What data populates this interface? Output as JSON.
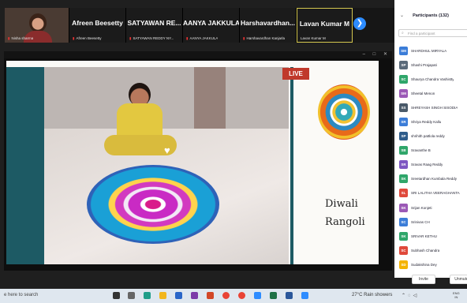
{
  "strip": {
    "self": {
      "name": "Nisha sharma"
    },
    "tiles": [
      {
        "big": "Afreen Beesetty",
        "small": "Afreen Beesetty"
      },
      {
        "big": "SATYAWAN RE...",
        "small": "SATYAWAN REDDY NY..."
      },
      {
        "big": "AANYA JAKKULA",
        "small": "AANYA JAKKULA"
      },
      {
        "big": "Harshavardhan...",
        "small": "Harshavardhan Kanjarla"
      },
      {
        "big": "Lavan Kumar M",
        "small": "Lavan Kumar M"
      }
    ],
    "next_icon": "chevron-right-icon"
  },
  "share": {
    "live_label": "LIVE",
    "title_line1": "Diwali",
    "title_line2": "Rangoli"
  },
  "panel": {
    "title": "Participants (132)",
    "search_placeholder": "Find a participant",
    "participants": [
      {
        "initials": "SM",
        "name": "SHARDHUL MIRYALA",
        "color": "#3b7dd8"
      },
      {
        "initials": "SP",
        "name": "Shashi Prajapati",
        "color": "#5a6a7a"
      },
      {
        "initials": "SC",
        "name": "Shaurya Chandra Vashistty",
        "color": "#2fa66a"
      },
      {
        "initials": "SM",
        "name": "Sheetal Menon",
        "color": "#9b59b6"
      },
      {
        "initials": "SS",
        "name": "SHREYASH SINGH SISODIA",
        "color": "#4a5a6a"
      },
      {
        "initials": "SR",
        "name": "Shriya Reddy Kallu",
        "color": "#3b7dd8"
      },
      {
        "initials": "SP",
        "name": "shrihith pattlola reddy",
        "color": "#2e5c8a"
      },
      {
        "initials": "SB",
        "name": "Sravanthe B",
        "color": "#2fa66a"
      },
      {
        "initials": "SR",
        "name": "Sravas Raag Reddy",
        "color": "#7e57c2"
      },
      {
        "initials": "SK",
        "name": "Sreetardhan Kumbala Reddy",
        "color": "#2fa66a"
      },
      {
        "initials": "SL",
        "name": "SRI LALITHA VEERAGHANTA",
        "color": "#e0493b"
      },
      {
        "initials": "SK",
        "name": "Srijan Konjeti",
        "color": "#9b59b6"
      },
      {
        "initials": "SC",
        "name": "Srinivas CH",
        "color": "#3b7dd8"
      },
      {
        "initials": "SK",
        "name": "SRIVAR KETHU",
        "color": "#2fa66a"
      },
      {
        "initials": "SC",
        "name": "Subhash Chandra",
        "color": "#e0493b"
      },
      {
        "initials": "SD",
        "name": "Sudakshina Dey",
        "color": "#f4b400"
      }
    ],
    "invite_label": "Invite",
    "unmute_label": "Unmute"
  },
  "taskbar": {
    "search_text": "e here to search",
    "weather": "27°C Rain showers",
    "lang_line1": "ENG",
    "lang_line2": "IN"
  }
}
